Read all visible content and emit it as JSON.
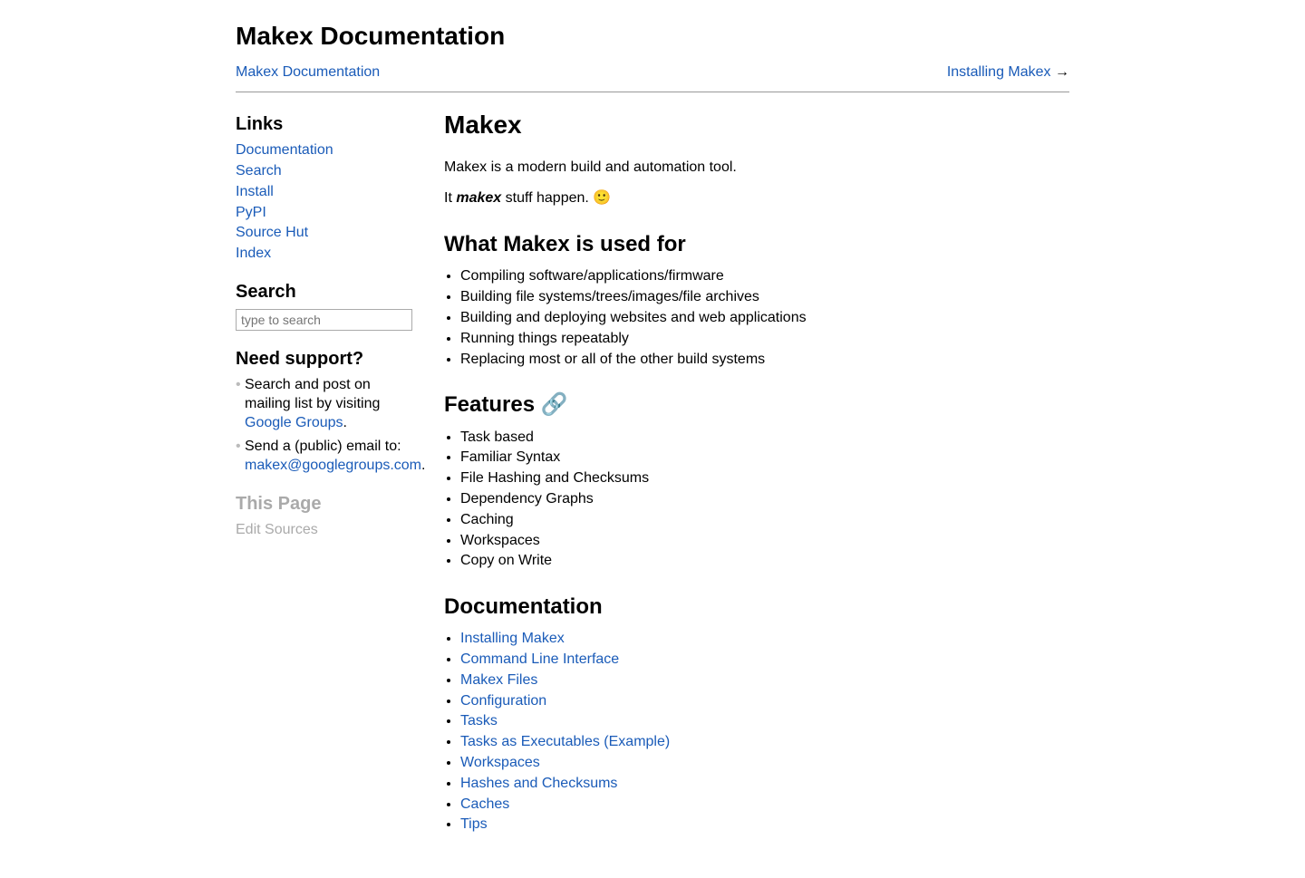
{
  "header": {
    "site_title": "Makex Documentation",
    "breadcrumb": "Makex Documentation",
    "next_label": "Installing Makex",
    "next_arrow": " →"
  },
  "sidebar": {
    "links_heading": "Links",
    "links": [
      "Documentation",
      "Search",
      "Install",
      "PyPI",
      "Source Hut",
      "Index"
    ],
    "search_heading": "Search",
    "search_placeholder": "type to search",
    "support_heading": "Need support?",
    "support_item1_pre": "Search and post on mailing list by visiting ",
    "support_item1_link": "Google Groups",
    "support_item1_post": ".",
    "support_item2_pre": "Send a (public) email to: ",
    "support_item2_link": "makex@googlegroups.com",
    "support_item2_post": ".",
    "this_page_heading": "This Page",
    "edit_sources": "Edit Sources"
  },
  "main": {
    "title": "Makex",
    "intro1": "Makex is a modern build and automation tool.",
    "intro2_pre": "It ",
    "intro2_em": "makex",
    "intro2_post": " stuff happen. 🙂",
    "usedfor_heading": "What Makex is used for",
    "usedfor": [
      "Compiling software/applications/firmware",
      "Building file systems/trees/images/file archives",
      "Building and deploying websites and web applications",
      "Running things repeatably",
      "Replacing most or all of the other build systems"
    ],
    "features_heading": "Features 🔗",
    "features": [
      "Task based",
      "Familiar Syntax",
      "File Hashing and Checksums",
      "Dependency Graphs",
      "Caching",
      "Workspaces",
      "Copy on Write"
    ],
    "docs_heading": "Documentation",
    "doc_links": [
      "Installing Makex",
      "Command Line Interface",
      "Makex Files",
      "Configuration",
      "Tasks",
      "Tasks as Executables (Example)",
      "Workspaces",
      "Hashes and Checksums",
      "Caches",
      "Tips"
    ]
  }
}
